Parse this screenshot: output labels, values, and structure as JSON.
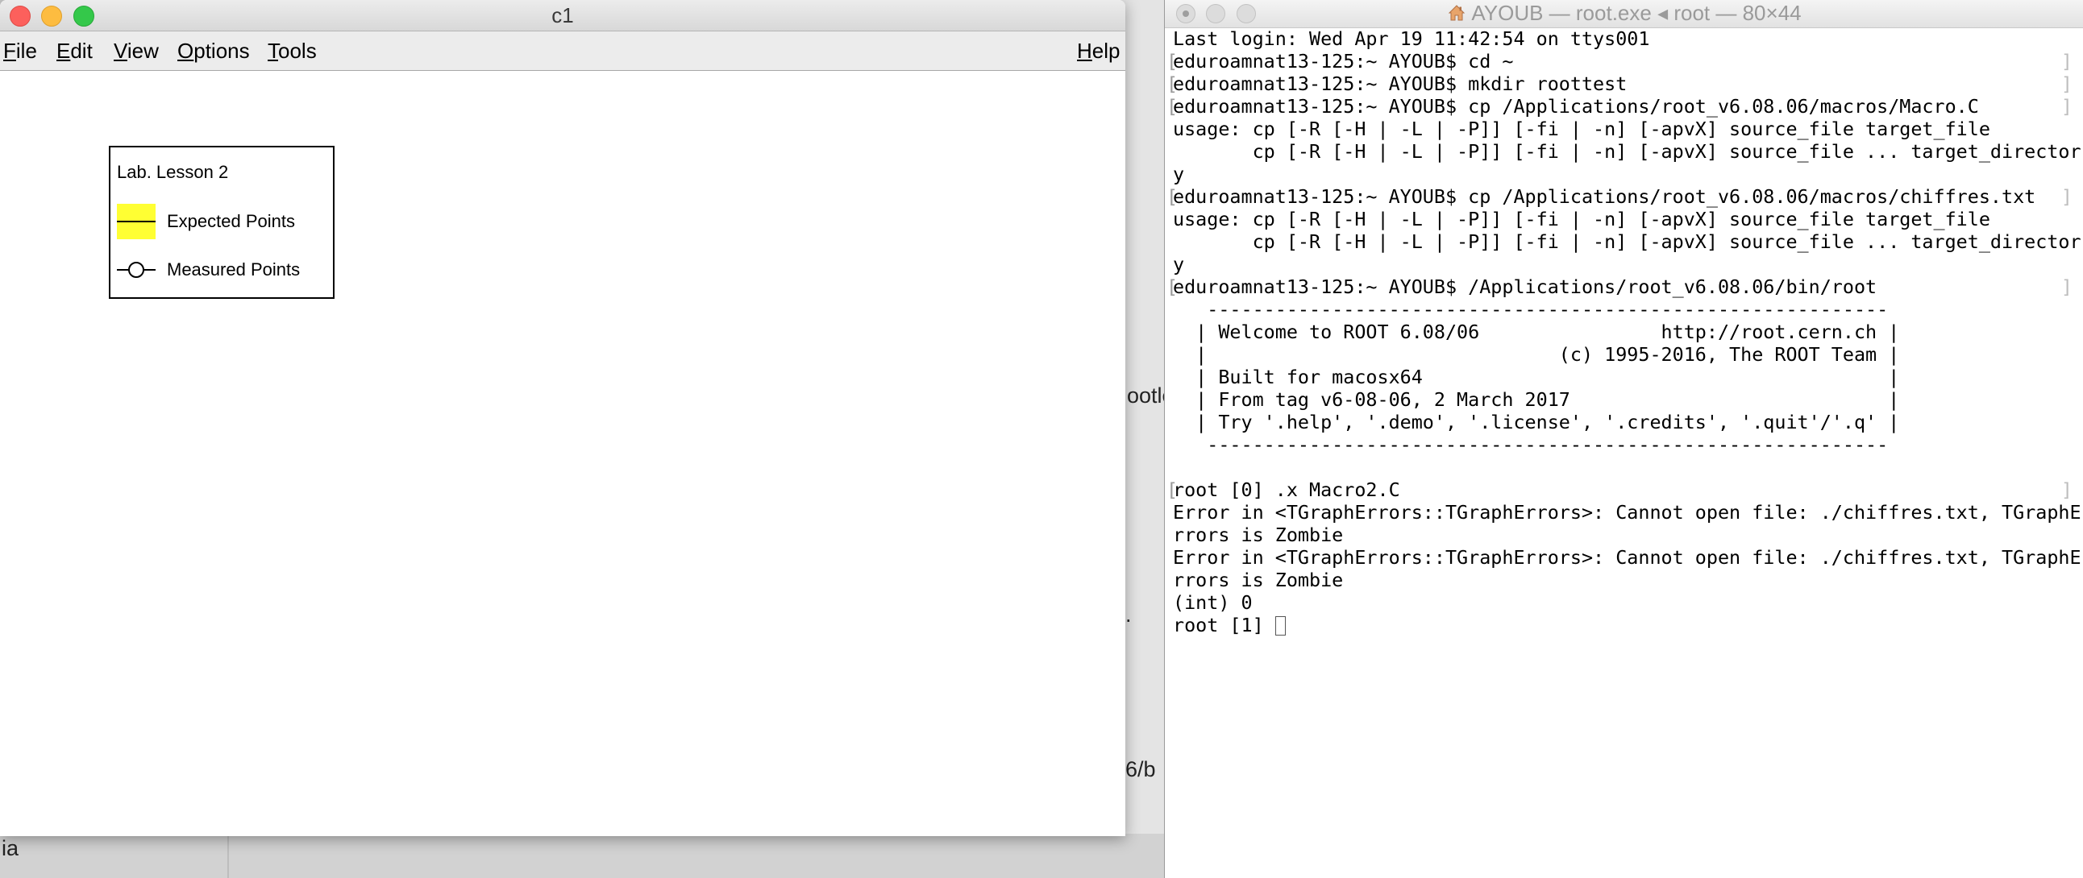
{
  "background": {
    "fragments": [
      "ootle",
      ".",
      "6/b",
      "ia"
    ]
  },
  "c1_window": {
    "title": "c1",
    "menu": {
      "file": {
        "u": "F",
        "rest": "ile"
      },
      "edit": {
        "u": "E",
        "rest": "dit"
      },
      "view": {
        "u": "V",
        "rest": "iew"
      },
      "options": {
        "u": "O",
        "rest": "ptions"
      },
      "tools": {
        "u": "T",
        "rest": "ools"
      },
      "help": {
        "u": "H",
        "rest": "elp"
      }
    },
    "legend": {
      "title": "Lab. Lesson 2",
      "entries": [
        {
          "label": "Expected Points",
          "fill_color": "#ffff33"
        },
        {
          "label": "Measured Points"
        }
      ]
    }
  },
  "terminal": {
    "title": "AYOUB — root.exe ◂ root — 80×44",
    "lines": [
      "Last login: Wed Apr 19 11:42:54 on ttys001",
      "eduroamnat13-125:~ AYOUB$ cd ~",
      "eduroamnat13-125:~ AYOUB$ mkdir roottest",
      "eduroamnat13-125:~ AYOUB$ cp /Applications/root_v6.08.06/macros/Macro.C",
      "usage: cp [-R [-H | -L | -P]] [-fi | -n] [-apvX] source_file target_file",
      "       cp [-R [-H | -L | -P]] [-fi | -n] [-apvX] source_file ... target_director",
      "y",
      "eduroamnat13-125:~ AYOUB$ cp /Applications/root_v6.08.06/macros/chiffres.txt",
      "usage: cp [-R [-H | -L | -P]] [-fi | -n] [-apvX] source_file target_file",
      "       cp [-R [-H | -L | -P]] [-fi | -n] [-apvX] source_file ... target_director",
      "y",
      "eduroamnat13-125:~ AYOUB$ /Applications/root_v6.08.06/bin/root",
      "   ------------------------------------------------------------",
      "  | Welcome to ROOT 6.08/06                http://root.cern.ch |",
      "  |                               (c) 1995-2016, The ROOT Team |",
      "  | Built for macosx64                                         |",
      "  | From tag v6-08-06, 2 March 2017                            |",
      "  | Try '.help', '.demo', '.license', '.credits', '.quit'/'.q' |",
      "   ------------------------------------------------------------",
      "",
      "root [0] .x Macro2.C",
      "Error in <TGraphErrors::TGraphErrors>: Cannot open file: ./chiffres.txt, TGraphE",
      "rrors is Zombie",
      "Error in <TGraphErrors::TGraphErrors>: Cannot open file: ./chiffres.txt, TGraphE",
      "rrors is Zombie",
      "(int) 0",
      "root [1] "
    ],
    "prompt_line_indices": [
      1,
      2,
      3,
      7,
      11,
      20
    ],
    "right_mark_indices": [
      1,
      2,
      3,
      7,
      11,
      20
    ]
  }
}
